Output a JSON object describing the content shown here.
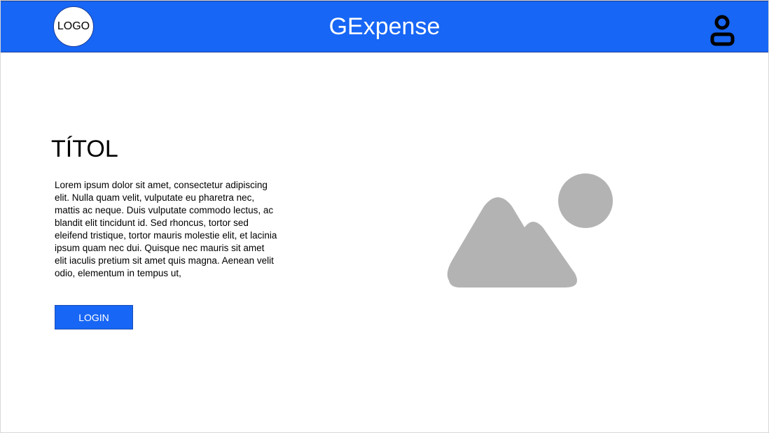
{
  "header": {
    "logo_label": "LOGO",
    "title": "GExpense",
    "icons": {
      "user": "user-icon"
    }
  },
  "main": {
    "headline": "TÍTOL",
    "body": "Lorem ipsum dolor sit amet, consectetur adipiscing elit. Nulla quam velit, vulputate eu pharetra nec, mattis ac neque. Duis vulputate commodo lectus, ac blandit elit tincidunt id. Sed rhoncus, tortor sed eleifend tristique, tortor mauris molestie elit, et lacinia ipsum quam nec dui. Quisque nec mauris sit amet elit iaculis pretium sit amet quis magna. Aenean velit odio, elementum in tempus ut,",
    "login_label": "LOGIN",
    "image_icon": "image-placeholder-icon"
  },
  "colors": {
    "brand": "#1766f5",
    "header_text": "#ffffff",
    "placeholder": "#b3b3b3"
  }
}
